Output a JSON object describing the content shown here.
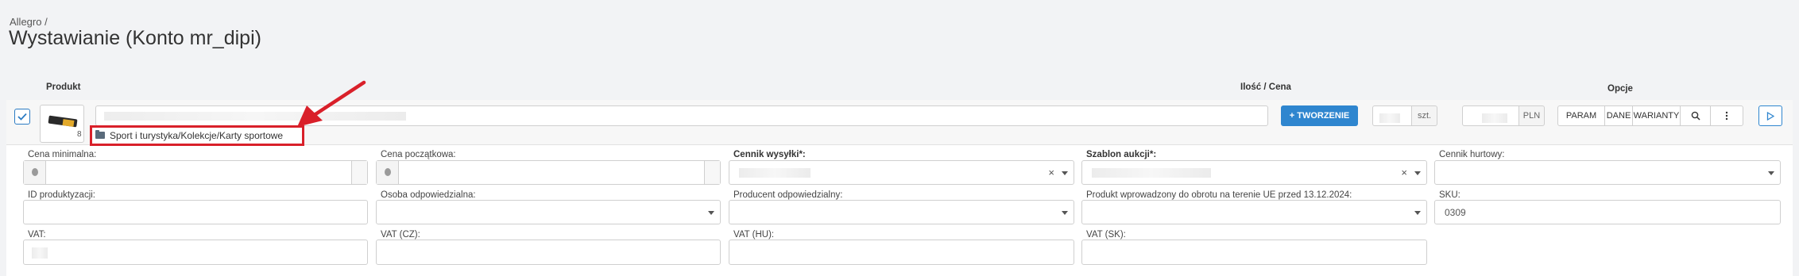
{
  "breadcrumb": "Allegro /",
  "page_title": "Wystawianie (Konto mr_dipi)",
  "columns": {
    "product": "Produkt",
    "qty_price": "Ilość / Cena",
    "options": "Opcje"
  },
  "product": {
    "image_count": "8",
    "name_value": "",
    "category_path": "Sport i turystyka/Kolekcje/Karty sportowe",
    "selected": true
  },
  "create_button": "+ TWORZENIE",
  "quantity": {
    "value": "",
    "unit": "szt."
  },
  "price": {
    "value": "",
    "unit": "PLN"
  },
  "options": {
    "param": "PARAM",
    "dane": "DANE",
    "warianty": "WARIANTY"
  },
  "icons": {
    "search": "search-icon",
    "more": "kebab-menu-icon",
    "play": "play-icon",
    "folder": "folder-icon",
    "check": "check-icon"
  },
  "accent_color": "#2f86cf",
  "highlight_color": "#d9202a",
  "fields": {
    "min_price": {
      "label": "Cena minimalna:",
      "value": ""
    },
    "start_price": {
      "label": "Cena początkowa:",
      "value": ""
    },
    "shipping_rates": {
      "label": "Cennik wysyłki*:",
      "value": ""
    },
    "auction_template": {
      "label": "Szablon aukcji*:",
      "value": ""
    },
    "wholesale_price": {
      "label": "Cennik hurtowy:",
      "value": ""
    },
    "production_id": {
      "label": "ID produktyzacji:",
      "value": ""
    },
    "responsible_person": {
      "label": "Osoba odpowiedzialna:",
      "value": ""
    },
    "responsible_producer": {
      "label": "Producent odpowiedzialny:",
      "value": ""
    },
    "eu_market": {
      "label": "Produkt wprowadzony do obrotu na terenie UE przed 13.12.2024:",
      "value": ""
    },
    "sku": {
      "label": "SKU:",
      "value": "0309"
    },
    "vat": {
      "label": "VAT:",
      "value": ""
    },
    "vat_cz": {
      "label": "VAT (CZ):",
      "value": ""
    },
    "vat_hu": {
      "label": "VAT (HU):",
      "value": ""
    },
    "vat_sk": {
      "label": "VAT (SK):",
      "value": ""
    }
  }
}
